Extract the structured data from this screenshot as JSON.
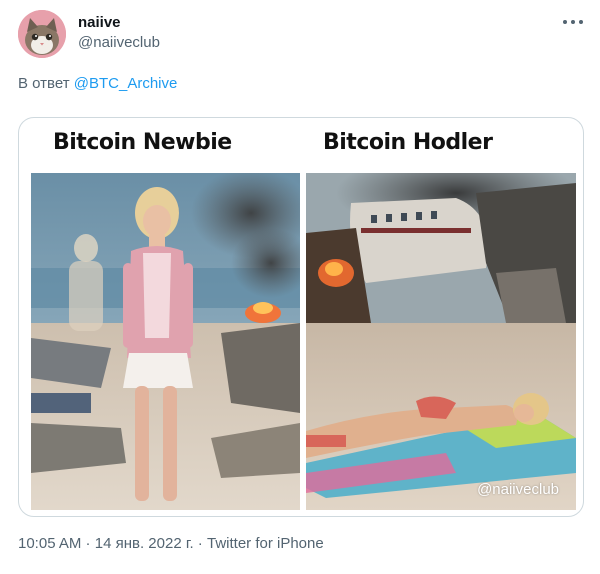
{
  "author": {
    "name": "naiive",
    "handle": "@naiiveclub"
  },
  "reply_to": {
    "prefix": "В ответ",
    "mention": "@BTC_Archive"
  },
  "media": {
    "left_title": "Bitcoin Newbie",
    "right_title": "Bitcoin Hodler",
    "watermark": "@naiiveclub"
  },
  "meta": {
    "time": "10:05 AM",
    "sep1": " · ",
    "date": "14 янв. 2022 г.",
    "sep2": " · ",
    "source": "Twitter for iPhone"
  },
  "icons": {
    "more": "more-icon",
    "avatar": "cat-avatar"
  },
  "colors": {
    "link": "#1d9bf0",
    "secondary": "#536471",
    "primary": "#0f1419",
    "border": "#cfd9de"
  }
}
